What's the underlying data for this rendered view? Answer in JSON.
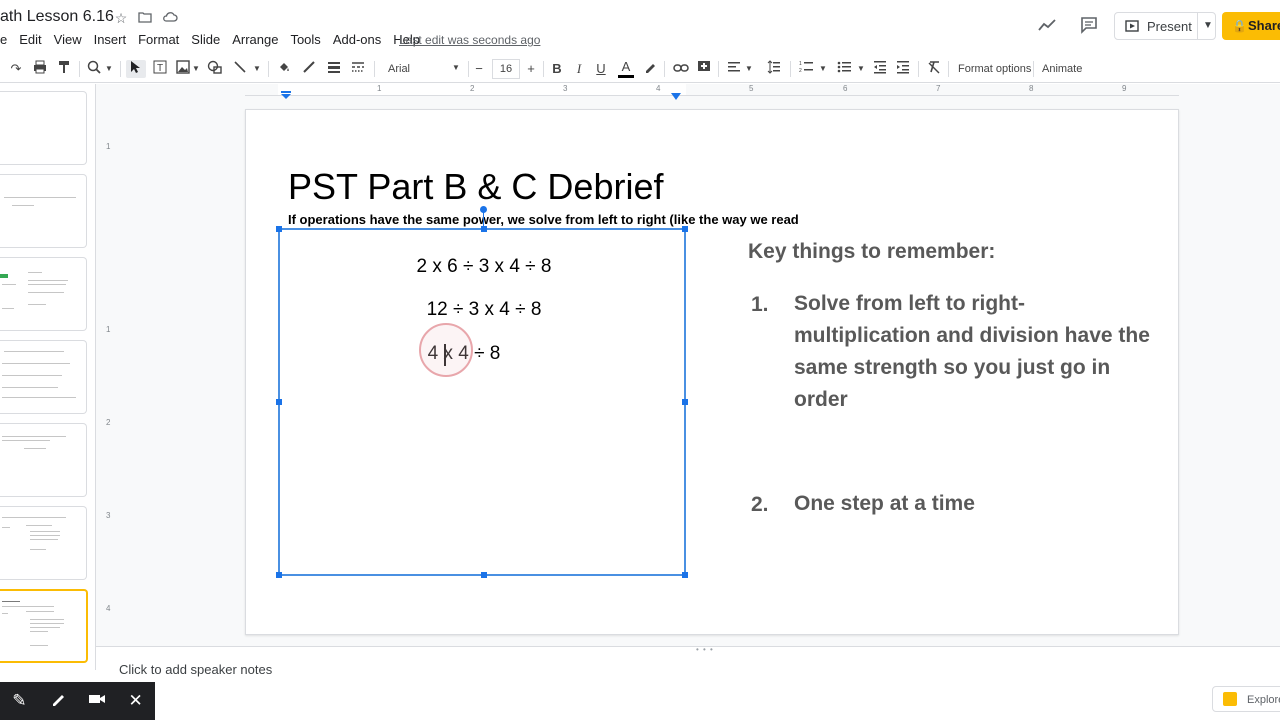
{
  "header": {
    "doc_title": "ath Lesson 6.16",
    "last_edit": "Last edit was seconds ago",
    "present_label": "Present",
    "share_label": "Share"
  },
  "menu": [
    "Edit",
    "View",
    "Insert",
    "Format",
    "Slide",
    "Arrange",
    "Tools",
    "Add-ons",
    "Help"
  ],
  "menu_prefix": "e",
  "toolbar": {
    "font_name": "Arial",
    "font_size": "16",
    "format_options": "Format options",
    "animate": "Animate"
  },
  "ruler": {
    "h_numbers": [
      "1",
      "2",
      "3",
      "4",
      "5",
      "6",
      "7",
      "8",
      "9"
    ],
    "v_numbers": [
      "1",
      "1",
      "2",
      "3",
      "4"
    ]
  },
  "slide": {
    "title": "PST Part B & C Debrief",
    "subtitle": "If operations have the same power, we solve from left to right (like the way we read",
    "expressions": [
      "2 x 6 ÷ 3 x 4 ÷ 8",
      "12 ÷ 3 x 4 ÷ 8",
      "4 x 4 ÷ 8"
    ],
    "key_heading": "Key things to remember:",
    "key_items": [
      {
        "num": "1.",
        "text": "Solve from left to right- multiplication and division have the same strength so you just go in order"
      },
      {
        "num": "2.",
        "text": "One step at a time"
      }
    ]
  },
  "notes": {
    "placeholder": "Click to add speaker notes"
  },
  "explore_label": "Explore",
  "colors": {
    "accent": "#1a73e8",
    "share_bg": "#fbbc04",
    "body_text": "#595959"
  }
}
